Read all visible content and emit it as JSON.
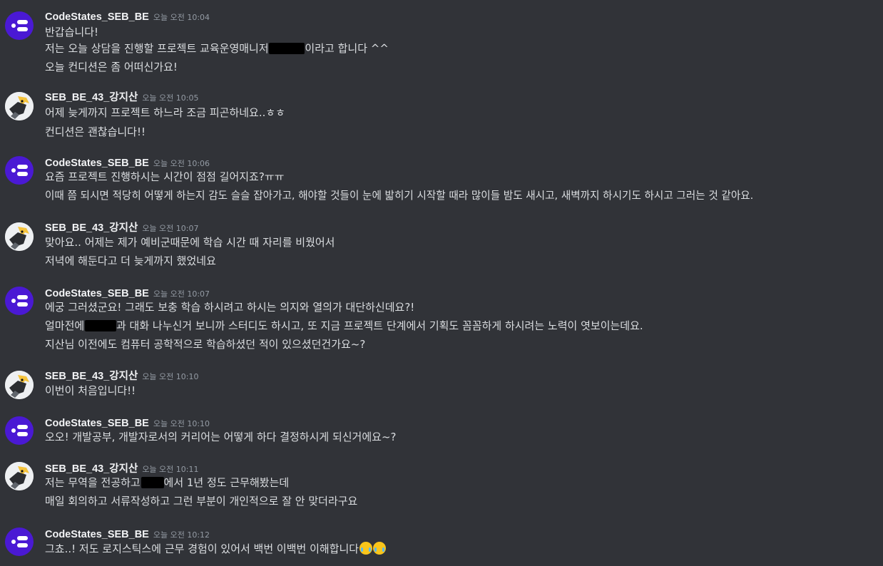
{
  "messages": [
    {
      "author": "CodeStates_SEB_BE",
      "time": "오늘 오전 10:04",
      "avatar": "codestates-logo",
      "lines": [
        {
          "pre": "반갑습니다!",
          "post": ""
        },
        {
          "pre": "저는 오늘 상담을 진행할 프로젝트 교육운영매니저 ",
          "post": "이라고 합니다 ^^"
        },
        {
          "pre": "오늘 컨디션은 좀 어떠신가요!",
          "post": ""
        }
      ]
    },
    {
      "author": "SEB_BE_43_강지산",
      "time": "오늘 오전 10:05",
      "avatar": "user-photo",
      "lines": [
        {
          "pre": "어제 늦게까지 프로젝트 하느라 조금 피곤하네요..ㅎㅎ",
          "post": ""
        },
        {
          "pre": "컨디션은 괜찮습니다!!",
          "post": ""
        }
      ]
    },
    {
      "author": "CodeStates_SEB_BE",
      "time": "오늘 오전 10:06",
      "avatar": "codestates-logo",
      "lines": [
        {
          "pre": "요즘 프로젝트 진행하시는 시간이 점점 길어지죠?ㅠㅠ",
          "post": ""
        },
        {
          "pre": "이때 쯤 되시면 적당히 어떻게 하는지 감도 슬슬 잡아가고, 해야할 것들이 눈에 밟히기 시작할 때라 많이들 밤도 새시고, 새벽까지 하시기도 하시고 그러는 것 같아요.",
          "post": ""
        }
      ]
    },
    {
      "author": "SEB_BE_43_강지산",
      "time": "오늘 오전 10:07",
      "avatar": "user-photo",
      "lines": [
        {
          "pre": "맞아요.. 어제는 제가 예비군때문에 학습 시간 때 자리를 비웠어서",
          "post": ""
        },
        {
          "pre": "저녁에 해둔다고 더 늦게까지 했었네요",
          "post": ""
        }
      ]
    },
    {
      "author": "CodeStates_SEB_BE",
      "time": "오늘 오전 10:07",
      "avatar": "codestates-logo",
      "lines": [
        {
          "pre": "에궁 그러셨군요! 그래도 보충 학습 하시려고 하시는 의지와 열의가 대단하신데요?!",
          "post": ""
        },
        {
          "pre": "얼마전에 ",
          "post": "과 대화 나누신거 보니까 스터디도 하시고, 또 지금 프로젝트 단계에서 기획도 꼼꼼하게 하시려는 노력이 엿보이는데요."
        },
        {
          "pre": "지산님 이전에도 컴퓨터 공학적으로 학습하셨던 적이 있으셨던건가요~?",
          "post": ""
        }
      ]
    },
    {
      "author": "SEB_BE_43_강지산",
      "time": "오늘 오전 10:10",
      "avatar": "user-photo",
      "lines": [
        {
          "pre": "이번이 처음입니다!!",
          "post": ""
        }
      ]
    },
    {
      "author": "CodeStates_SEB_BE",
      "time": "오늘 오전 10:10",
      "avatar": "codestates-logo",
      "lines": [
        {
          "pre": "오오! 개발공부, 개발자로서의 커리어는 어떻게 하다 결정하시게 되신거에요~?",
          "post": ""
        }
      ]
    },
    {
      "author": "SEB_BE_43_강지산",
      "time": "오늘 오전 10:11",
      "avatar": "user-photo",
      "lines": [
        {
          "pre": "저는 무역을 전공하고 ",
          "post": "에서 1년 정도 근무해봤는데"
        },
        {
          "pre": "매일 회의하고 서류작성하고 그런 부분이 개인적으로 잘 안 맞더라구요",
          "post": ""
        }
      ]
    },
    {
      "author": "CodeStates_SEB_BE",
      "time": "오늘 오전 10:12",
      "avatar": "codestates-logo",
      "lines": [
        {
          "pre": "그쵸..! 저도 로지스틱스에 근무 경험이 있어서 백번 이백번 이해합니다",
          "post": "",
          "emoji": [
            "😂",
            "😂"
          ]
        }
      ]
    }
  ]
}
